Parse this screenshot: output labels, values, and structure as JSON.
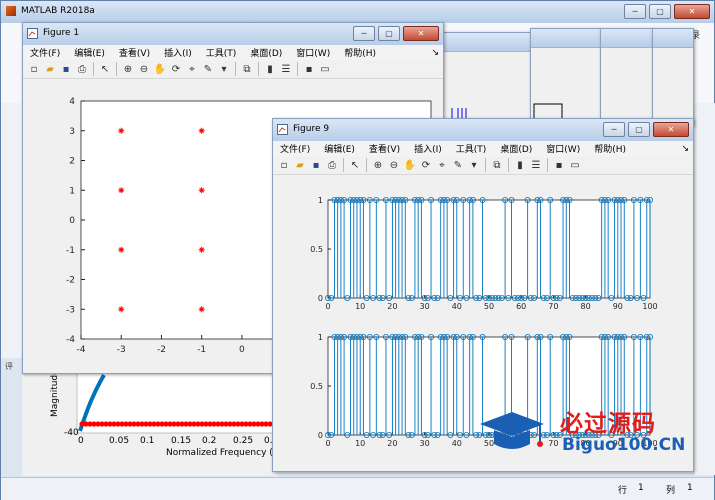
{
  "matlab": {
    "title": "MATLAB R2018a",
    "right_login": "录",
    "status_page": "行",
    "status_col1": "1",
    "status_col_label": "列",
    "status_col2": "1"
  },
  "figure1": {
    "title": "Figure 1",
    "menu": [
      "文件(F)",
      "编辑(E)",
      "查看(V)",
      "插入(I)",
      "工具(T)",
      "桌面(D)",
      "窗口(W)",
      "帮助(H)"
    ],
    "y_ticks": [
      "4",
      "3",
      "2",
      "1",
      "0",
      "-1",
      "-2",
      "-3",
      "-4"
    ],
    "x_ticks": [
      "-4",
      "-3",
      "-2",
      "-1",
      "0"
    ]
  },
  "figure9": {
    "title": "Figure 9",
    "menu": [
      "文件(F)",
      "编辑(E)",
      "查看(V)",
      "插入(I)",
      "工具(T)",
      "桌面(D)",
      "窗口(W)",
      "帮助(H)"
    ],
    "y_ticks_top": [
      "1",
      "0.5",
      "0"
    ],
    "y_ticks_bottom": [
      "1",
      "0.5",
      "0"
    ],
    "x_ticks_top": [
      "0",
      "10",
      "20",
      "30",
      "40",
      "50",
      "60",
      "70",
      "80",
      "90",
      "100"
    ],
    "x_ticks_bottom": [
      "0",
      "10",
      "20",
      "30",
      "40",
      "50",
      "60",
      "70",
      "80",
      "90",
      "100"
    ]
  },
  "bg_plot": {
    "ylabel": "Magnitude",
    "y_tick": "-40",
    "x_ticks": [
      "0",
      "0.05",
      "0.1",
      "0.15",
      "0.2",
      "0.25",
      "0.3"
    ],
    "xlabel": "Normalized Frequency (",
    "truncated_label": "评"
  },
  "watermark": {
    "text": "必过源码",
    "url": "Biguo100.CN"
  },
  "icons": {
    "menu_arrow": "↘",
    "close": "✕",
    "restore": "▢",
    "minimize": "─"
  },
  "colors": {
    "accent_blue": "#0072bd",
    "marker_red": "#ff0000",
    "watermark_red": "#e21b1b",
    "watermark_blue": "#1b5fb5"
  }
}
